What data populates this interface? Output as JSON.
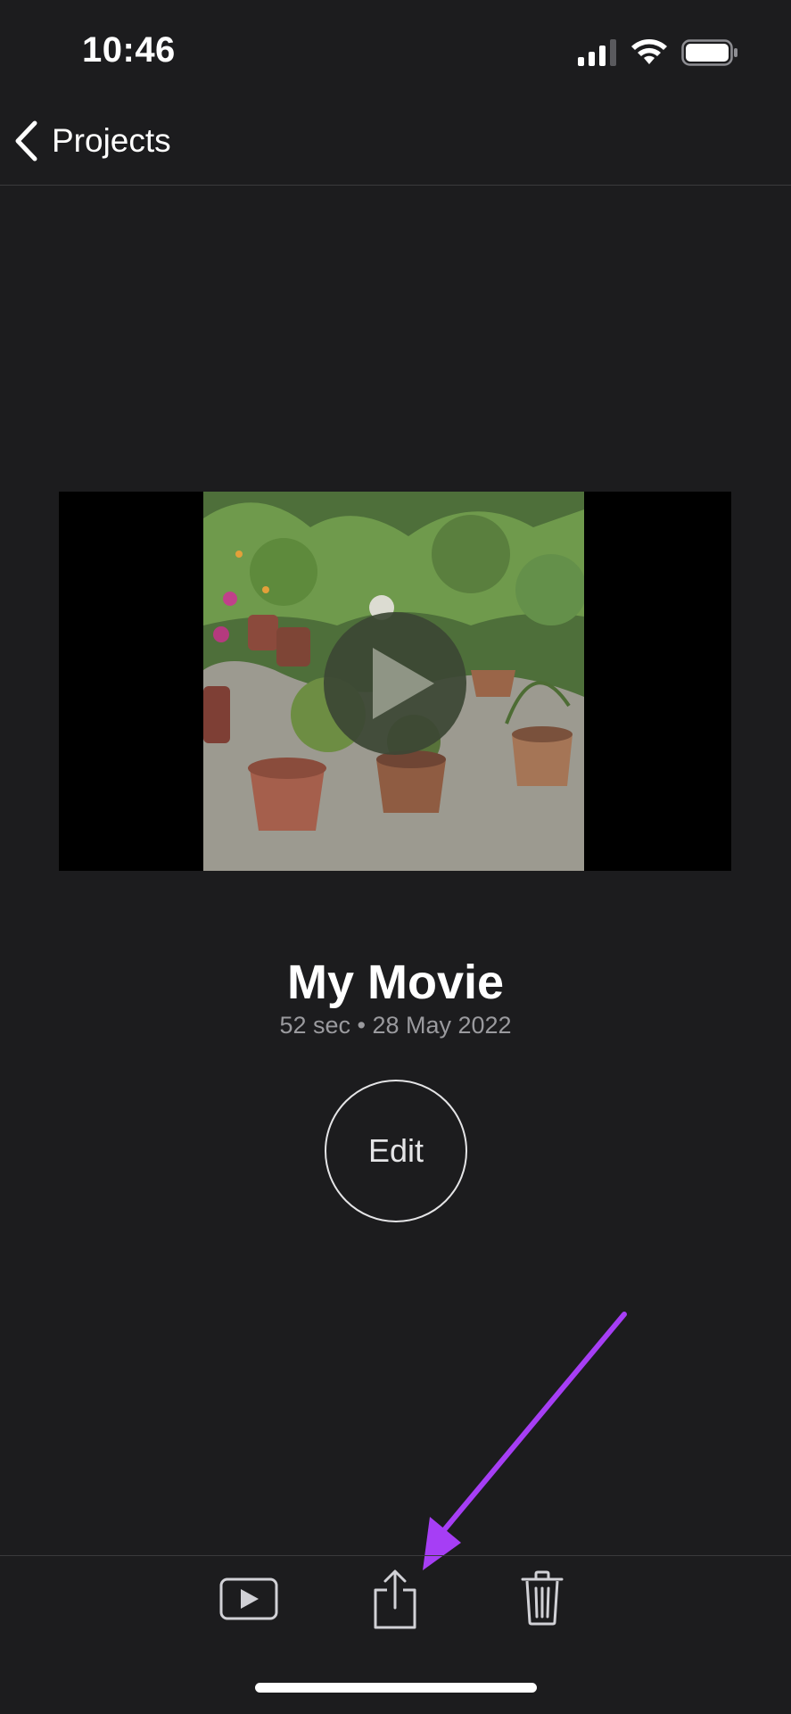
{
  "status_bar": {
    "time": "10:46",
    "signal_icon": "cellular-signal-icon",
    "wifi_icon": "wifi-icon",
    "battery_icon": "battery-icon"
  },
  "nav": {
    "back_label": "Projects",
    "back_icon": "chevron-left-icon"
  },
  "project": {
    "title": "My Movie",
    "meta": "52 sec • 28 May 2022",
    "play_icon": "play-icon",
    "edit_label": "Edit"
  },
  "toolbar": {
    "play_icon": "play-rectangle-icon",
    "share_icon": "share-icon",
    "delete_icon": "trash-icon"
  },
  "colors": {
    "background": "#1c1c1e",
    "divider": "#3a3a3c",
    "secondary_text": "#9a9a9e",
    "annotation_arrow": "#a63ef5"
  }
}
